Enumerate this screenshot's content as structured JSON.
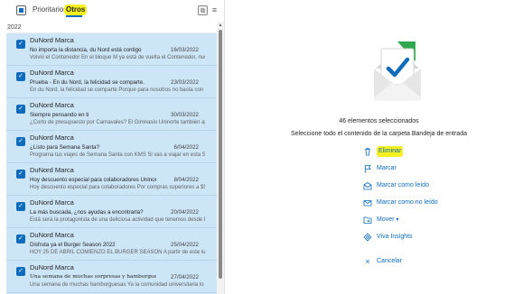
{
  "tabs": {
    "focused": "Prioritarios",
    "other": "Otros"
  },
  "icons": {
    "copy": "copy-icon",
    "filter": "filter-icon",
    "select_all": "select-all-checkbox-icon"
  },
  "colors": {
    "accent": "#0f6cbd",
    "selection_bg": "#cde6f7",
    "highlight": "#f7f21f"
  },
  "list": {
    "group_header": "2022",
    "items": [
      {
        "sender": "DuNord Marca",
        "subject": "No importa la distancia, du Nord está contigo",
        "date": "16/03/2022",
        "preview": "Volvió el Contenedor En el bloque M ya está de vuelta el Contenedor, nuestro gran aliado para"
      },
      {
        "sender": "DuNord Marca",
        "subject": "Prueba - En du Nord, la felicidad se comparte.",
        "date": "23/03/2022",
        "preview": "En du Nord, la felicidad se comparte Porque para nosotros no basta con que vivas una buena"
      },
      {
        "sender": "DuNord Marca",
        "subject": "Siempre pensando en ti",
        "date": "30/03/2022",
        "preview": "¿Corto de presupuesto por Carnavales? El Gimnasio Uninorte también aporta para tu diversión"
      },
      {
        "sender": "DuNord Marca",
        "subject": "¿Listo para Semana Santa?",
        "date": "6/04/2022",
        "preview": "Programa tus viajes de Semana Santa con KMS Si vas a viajar en esta Semana Santa, comunícate"
      },
      {
        "sender": "DuNord Marca",
        "subject": "Hoy descuento especial para colaboradores Uninorte",
        "date": "8/04/2022",
        "preview": "Hoy descuento especial para colaboradores Por compras superiores a $50.000 en todos nuestros"
      },
      {
        "sender": "DuNord Marca",
        "subject": "La más buscada, ¿nos ayudas a encontrarla?",
        "date": "20/04/2022",
        "preview": "Está será la protagonista de una deliciosa actividad que tenemos desde DuNord para ti"
      },
      {
        "sender": "DuNord Marca",
        "subject": "Disfruta ya el Burger Season 2022",
        "date": "25/04/2022",
        "preview": "HOY 25 DE ABRIL COMIENZO EL BURGER SEASON A partir de este lunes 25 de abril estará"
      },
      {
        "sender": "DuNord Marca",
        "subject": "Una semana de muchas sorpresas y hamburguesas",
        "date": "27/04/2022",
        "preview": "Una semana de muchas hamburguesas Ya la comunidad universitaria lo sabe: una"
      }
    ]
  },
  "detail": {
    "illustration": "envelope-check-icon",
    "selected_count": "46 elementos seleccionados",
    "select_all_text": "Seleccione todo el contenido de la carpeta Bandeja de entrada",
    "actions": {
      "delete": "Eliminar",
      "flag": "Marcar",
      "mark_read": "Marcar como leído",
      "mark_unread": "Marcar como no leído",
      "move": "Mover",
      "insights": "Viva Insights",
      "cancel": "Cancelar"
    }
  }
}
